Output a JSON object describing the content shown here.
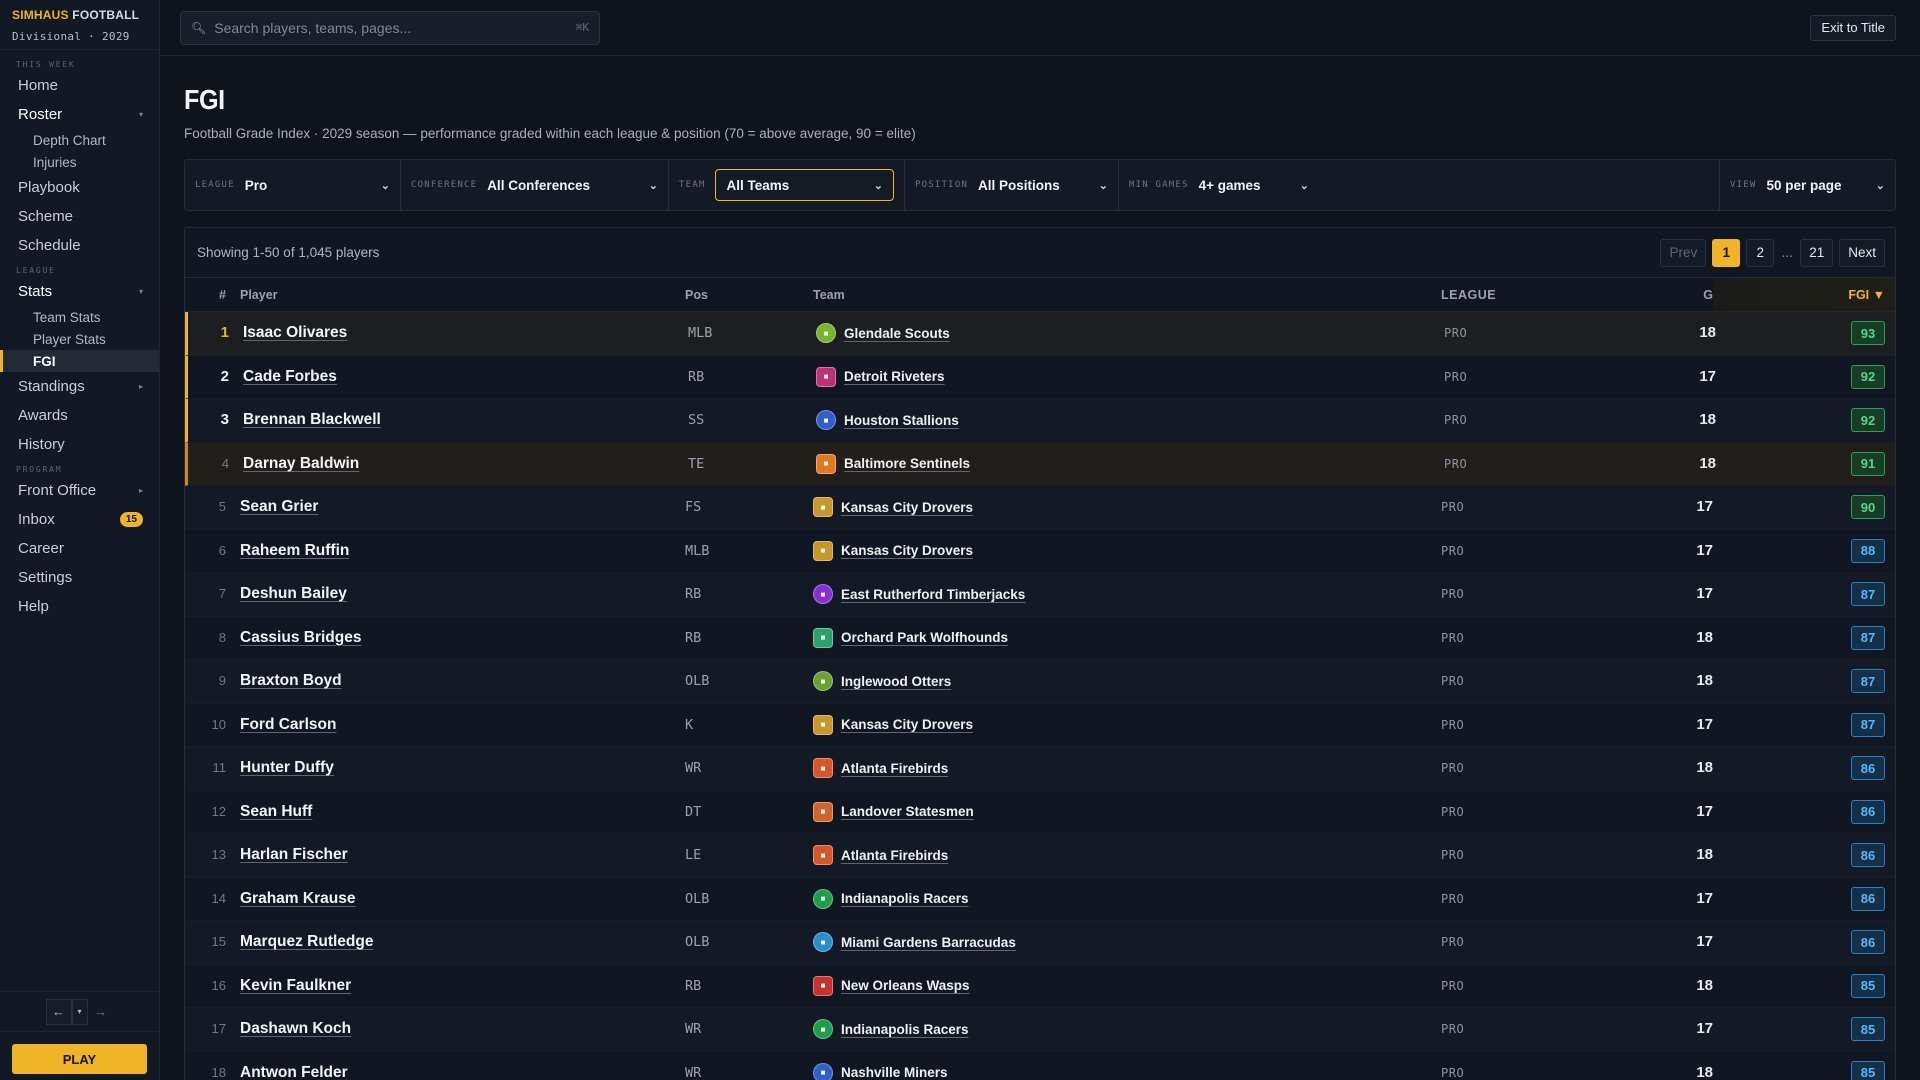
{
  "brand": {
    "name_a": "SIMHAUS",
    "name_b": "FOOTBALL",
    "subtitle": "Divisional · 2029"
  },
  "nav": {
    "this_week": "THIS WEEK",
    "home": "Home",
    "roster": "Roster",
    "depth_chart": "Depth Chart",
    "injuries": "Injuries",
    "playbook": "Playbook",
    "scheme": "Scheme",
    "schedule": "Schedule",
    "league_section": "LEAGUE",
    "stats": "Stats",
    "team_stats": "Team Stats",
    "player_stats": "Player Stats",
    "fgi": "FGI",
    "standings": "Standings",
    "awards": "Awards",
    "history": "History",
    "program_section": "PROGRAM",
    "front_office": "Front Office",
    "inbox": "Inbox",
    "inbox_badge": "15",
    "career": "Career",
    "settings": "Settings",
    "help": "Help",
    "play": "PLAY"
  },
  "topbar": {
    "search_placeholder": "Search players, teams, pages...",
    "shortcut": "⌘K",
    "exit": "Exit to Title"
  },
  "page": {
    "title": "FGI",
    "subtitle": "Football Grade Index · 2029 season — performance graded within each league & position (70 = above average, 90 = elite)"
  },
  "filters": {
    "league_label": "LEAGUE",
    "league_value": "Pro",
    "conference_label": "CONFERENCE",
    "conference_value": "All Conferences",
    "team_label": "TEAM",
    "team_value": "All Teams",
    "position_label": "POSITION",
    "position_value": "All Positions",
    "min_games_label": "MIN GAMES",
    "min_games_value": "4+ games",
    "view_label": "VIEW",
    "view_value": "50 per page"
  },
  "table": {
    "showing": "Showing 1-50 of 1,045 players",
    "pager": {
      "prev": "Prev",
      "p1": "1",
      "p2": "2",
      "ellipsis": "...",
      "p_last": "21",
      "next": "Next"
    },
    "headers": {
      "rank": "#",
      "player": "Player",
      "pos": "Pos",
      "team": "Team",
      "league": "LEAGUE",
      "g": "G",
      "fgi": "FGI ▼"
    },
    "rows": [
      {
        "rank": "1",
        "player": "Isaac Olivares",
        "pos": "MLB",
        "team": "Glendale Scouts",
        "league": "PRO",
        "g": "18",
        "fgi": "93",
        "color": "#7bb32e",
        "shape": "circle"
      },
      {
        "rank": "2",
        "player": "Cade Forbes",
        "pos": "RB",
        "team": "Detroit Riveters",
        "league": "PRO",
        "g": "17",
        "fgi": "92",
        "color": "#c0307a",
        "shape": "sq"
      },
      {
        "rank": "3",
        "player": "Brennan Blackwell",
        "pos": "SS",
        "team": "Houston Stallions",
        "league": "PRO",
        "g": "18",
        "fgi": "92",
        "color": "#2f5fc9",
        "shape": "circle"
      },
      {
        "rank": "4",
        "player": "Darnay Baldwin",
        "pos": "TE",
        "team": "Baltimore Sentinels",
        "league": "PRO",
        "g": "18",
        "fgi": "91",
        "color": "#e07a22",
        "shape": "sq"
      },
      {
        "rank": "5",
        "player": "Sean Grier",
        "pos": "FS",
        "team": "Kansas City Drovers",
        "league": "PRO",
        "g": "17",
        "fgi": "90",
        "color": "#c9962a",
        "shape": "sq"
      },
      {
        "rank": "6",
        "player": "Raheem Ruffin",
        "pos": "MLB",
        "team": "Kansas City Drovers",
        "league": "PRO",
        "g": "17",
        "fgi": "88",
        "color": "#c9962a",
        "shape": "sq"
      },
      {
        "rank": "7",
        "player": "Deshun Bailey",
        "pos": "RB",
        "team": "East Rutherford Timberjacks",
        "league": "PRO",
        "g": "17",
        "fgi": "87",
        "color": "#8a2fd1",
        "shape": "circle"
      },
      {
        "rank": "8",
        "player": "Cassius Bridges",
        "pos": "RB",
        "team": "Orchard Park Wolfhounds",
        "league": "PRO",
        "g": "18",
        "fgi": "87",
        "color": "#2aa36a",
        "shape": "sq"
      },
      {
        "rank": "9",
        "player": "Braxton Boyd",
        "pos": "OLB",
        "team": "Inglewood Otters",
        "league": "PRO",
        "g": "18",
        "fgi": "87",
        "color": "#6aa32e",
        "shape": "circle"
      },
      {
        "rank": "10",
        "player": "Ford Carlson",
        "pos": "K",
        "team": "Kansas City Drovers",
        "league": "PRO",
        "g": "17",
        "fgi": "87",
        "color": "#c9962a",
        "shape": "sq"
      },
      {
        "rank": "11",
        "player": "Hunter Duffy",
        "pos": "WR",
        "team": "Atlanta Firebirds",
        "league": "PRO",
        "g": "18",
        "fgi": "86",
        "color": "#d4562a",
        "shape": "sq"
      },
      {
        "rank": "12",
        "player": "Sean Huff",
        "pos": "DT",
        "team": "Landover Statesmen",
        "league": "PRO",
        "g": "17",
        "fgi": "86",
        "color": "#d0642a",
        "shape": "sq"
      },
      {
        "rank": "13",
        "player": "Harlan Fischer",
        "pos": "LE",
        "team": "Atlanta Firebirds",
        "league": "PRO",
        "g": "18",
        "fgi": "86",
        "color": "#d4562a",
        "shape": "sq"
      },
      {
        "rank": "14",
        "player": "Graham Krause",
        "pos": "OLB",
        "team": "Indianapolis Racers",
        "league": "PRO",
        "g": "17",
        "fgi": "86",
        "color": "#1f9e4a",
        "shape": "circle"
      },
      {
        "rank": "15",
        "player": "Marquez Rutledge",
        "pos": "OLB",
        "team": "Miami Gardens Barracudas",
        "league": "PRO",
        "g": "17",
        "fgi": "86",
        "color": "#2a8fc9",
        "shape": "circle"
      },
      {
        "rank": "16",
        "player": "Kevin Faulkner",
        "pos": "RB",
        "team": "New Orleans Wasps",
        "league": "PRO",
        "g": "18",
        "fgi": "85",
        "color": "#c9302f",
        "shape": "sq"
      },
      {
        "rank": "17",
        "player": "Dashawn Koch",
        "pos": "WR",
        "team": "Indianapolis Racers",
        "league": "PRO",
        "g": "17",
        "fgi": "85",
        "color": "#1f9e4a",
        "shape": "circle"
      },
      {
        "rank": "18",
        "player": "Antwon Felder",
        "pos": "WR",
        "team": "Nashville Miners",
        "league": "PRO",
        "g": "18",
        "fgi": "85",
        "color": "#2f5fc9",
        "shape": "circle"
      }
    ]
  }
}
